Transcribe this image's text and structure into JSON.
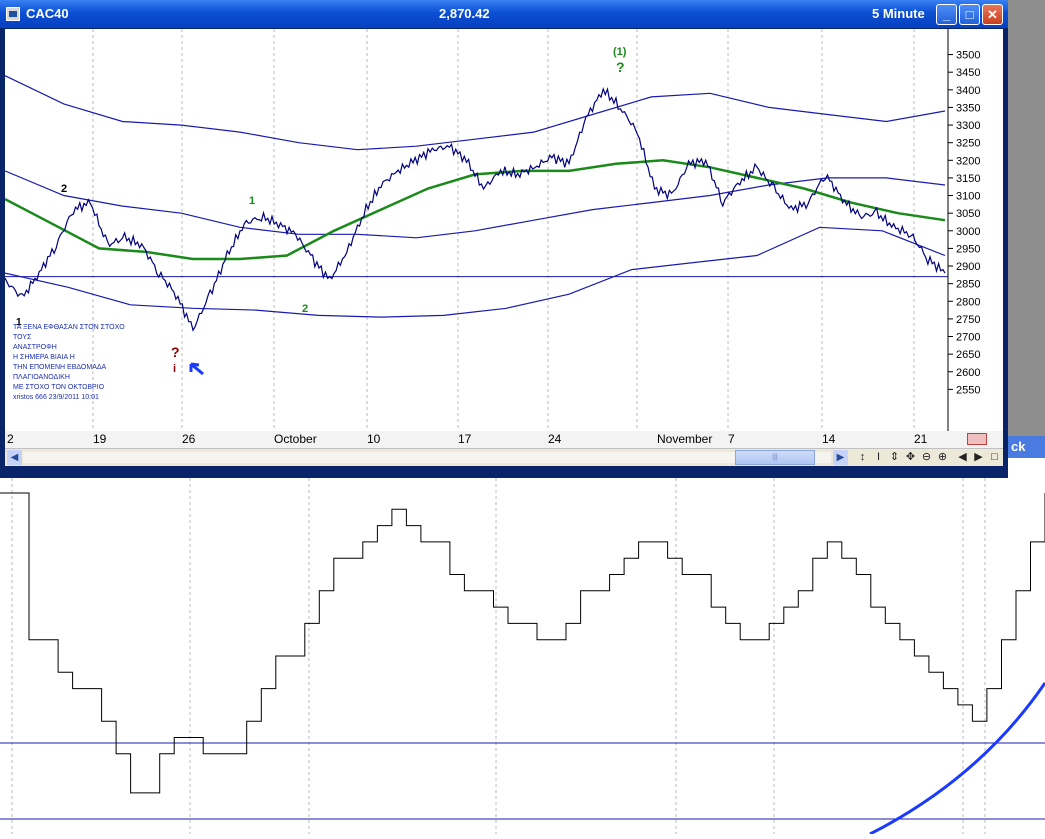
{
  "window": {
    "symbol": "CAC40",
    "last_price": "2,870.42",
    "interval": "5 Minute",
    "minimize_label": "_",
    "maximize_label": "□",
    "close_label": "✕",
    "edge_button_label": "ck"
  },
  "annotations": {
    "greek_note": [
      "ΤΑ ΞΕΝΑ ΕΦΘΑΣΑΝ ΣΤΟΝ ΣΤΟΧΟ",
      "ΤΟΥΣ",
      "ΑΝΑΣΤΡΟΦΗ",
      "Η ΣΗΜΕΡΑ ΒΙΑΙΑ Η",
      "ΤΗΝ ΕΠΟΜΕΝΗ ΕΒΔΟΜΑΔΑ",
      "ΠΛΑΓΙΟΑΝΟΔΙΚΗ",
      "ΜΕ ΣΤΟΧΟ ΤΟΝ ΟΚΤΩΒΡΙΟ",
      "xristos 666   23/9/2011 10:01"
    ],
    "wave_labels": [
      {
        "text": "1",
        "color": "#000000"
      },
      {
        "text": "2",
        "color": "#000000"
      },
      {
        "text": "1",
        "color": "#1a8a1a"
      },
      {
        "text": "2",
        "color": "#1a8a1a"
      },
      {
        "text": "(1)",
        "color": "#1a8a1a"
      },
      {
        "text": "?",
        "color": "#1a8a1a"
      },
      {
        "text": "?",
        "color": "#8b0000"
      },
      {
        "text": "i",
        "color": "#8b0000"
      }
    ]
  },
  "chart_data": {
    "type": "line",
    "symbol": "CAC40",
    "ylim": [
      2500,
      3530
    ],
    "y_ticks": [
      "3500",
      "3450",
      "3400",
      "3350",
      "3300",
      "3250",
      "3200",
      "3150",
      "3100",
      "3050",
      "3000",
      "2950",
      "2900",
      "2850",
      "2800",
      "2750",
      "2700",
      "2650",
      "2600",
      "2550"
    ],
    "x_ticks": [
      "2",
      "19",
      "26",
      "October",
      "10",
      "17",
      "24",
      "November",
      "7",
      "14",
      "21"
    ],
    "horizontal_line": 2870,
    "series": [
      {
        "kind": "price",
        "color": "#000080",
        "values": [
          2860,
          2810,
          2880,
          2960,
          3060,
          3080,
          2960,
          2980,
          2960,
          2880,
          2820,
          2720,
          2820,
          2930,
          3020,
          3040,
          3020,
          2990,
          2920,
          2860,
          2940,
          3050,
          3130,
          3170,
          3200,
          3230,
          3240,
          3200,
          3120,
          3170,
          3160,
          3180,
          3210,
          3190,
          3320,
          3400,
          3350,
          3280,
          3120,
          3100,
          3190,
          3200,
          3080,
          3140,
          3180,
          3120,
          3060,
          3080,
          3160,
          3090,
          3040,
          3050,
          3010,
          2990,
          2920,
          2880
        ]
      },
      {
        "kind": "moving-average",
        "color": "#1a8a1a",
        "values": [
          3090,
          3020,
          2950,
          2940,
          2920,
          2920,
          2930,
          3000,
          3060,
          3120,
          3160,
          3170,
          3170,
          3190,
          3200,
          3180,
          3150,
          3120,
          3080,
          3050,
          3030
        ]
      },
      {
        "kind": "band-upper",
        "color": "#1a1ab0",
        "values": [
          3440,
          3360,
          3310,
          3300,
          3280,
          3250,
          3230,
          3240,
          3260,
          3280,
          3330,
          3380,
          3390,
          3350,
          3330,
          3310,
          3340
        ]
      },
      {
        "kind": "band-middle",
        "color": "#1a1ab0",
        "values": [
          3170,
          3100,
          3070,
          3050,
          3010,
          2990,
          2990,
          2980,
          3000,
          3030,
          3060,
          3080,
          3100,
          3130,
          3150,
          3150,
          3130
        ]
      },
      {
        "kind": "band-lower",
        "color": "#1a1ab0",
        "values": [
          2880,
          2840,
          2790,
          2780,
          2775,
          2760,
          2755,
          2760,
          2780,
          2820,
          2890,
          2910,
          2930,
          3010,
          3000,
          2930
        ]
      }
    ],
    "oscillator": {
      "color": "#000000",
      "levels": [
        "upper-guide",
        "lower-guide"
      ],
      "values": [
        100,
        100,
        55,
        55,
        45,
        40,
        40,
        30,
        20,
        8,
        8,
        20,
        25,
        25,
        20,
        20,
        20,
        30,
        40,
        50,
        50,
        60,
        70,
        80,
        80,
        85,
        90,
        95,
        90,
        85,
        85,
        75,
        70,
        70,
        65,
        60,
        60,
        55,
        55,
        60,
        70,
        70,
        75,
        80,
        85,
        85,
        80,
        75,
        75,
        65,
        60,
        55,
        55,
        60,
        65,
        70,
        80,
        85,
        80,
        75,
        65,
        60,
        55,
        50,
        45,
        40,
        35,
        30,
        40,
        55,
        70,
        85,
        100
      ]
    }
  }
}
